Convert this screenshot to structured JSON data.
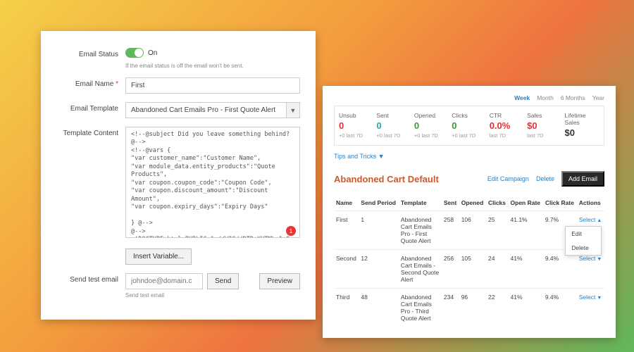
{
  "left": {
    "status": {
      "label": "Email Status",
      "value": "On",
      "hint": "If the email status is off the email won't be sent."
    },
    "name": {
      "label": "Email Name",
      "required": "*",
      "value": "First"
    },
    "template": {
      "label": "Email Template",
      "value": "Abandoned Cart Emails Pro - First Quote Alert"
    },
    "content": {
      "label": "Template Content",
      "value": "<!--@subject Did you leave something behind? @-->\n<!--@vars {\n\"var customer_name\":\"Customer Name\",\n\"var module_data.entity_products\":\"Quote Products\",\n\"var coupon.coupon_code\":\"Coupon Code\",\n\"var coupon.discount_amount\":\"Discount Amount\",\n\"var coupon.expiry_days\":\"Expiry Days\"\n\n} @-->\n@-->\n<!DOCTYPE html PUBLIC \"-//W3C//DTD XHTML 1.0 Transitional//EN\"\n\"http://www.w3.org/TR/xhtml1/DTD/xhtml1-transitional.dtd\">\n<html xmlns:v=\"urn:schemas-microsoft-com:vml\">\n<head>\n  <meta http-equiv=\"Content-Type\" content=\"text/html; charset=UTF-8\" />",
      "badge": "1"
    },
    "insert": "Insert Variable...",
    "test": {
      "label": "Send test email",
      "placeholder": "johndoe@domain.c",
      "send": "Send",
      "preview": "Preview",
      "hint": "Send test email"
    }
  },
  "right": {
    "periods": [
      "Week",
      "Month",
      "6 Months",
      "Year"
    ],
    "stats": [
      {
        "title": "Unsub",
        "val": "0",
        "sub": "+0 last 7D",
        "cls": "v-red"
      },
      {
        "title": "Sent",
        "val": "0",
        "sub": "+0 last 7D",
        "cls": "v-teal"
      },
      {
        "title": "Opened",
        "val": "0",
        "sub": "+0 last 7D",
        "cls": "v-green"
      },
      {
        "title": "Clicks",
        "val": "0",
        "sub": "+0 last 7D",
        "cls": "v-green"
      },
      {
        "title": "CTR",
        "val": "0.0%",
        "sub": "last 7D",
        "cls": "v-red"
      },
      {
        "title": "Sales",
        "val": "$0",
        "sub": "last 7D",
        "cls": "v-red"
      },
      {
        "title": "Lifetime Sales",
        "val": "$0",
        "sub": "",
        "cls": "v-dark"
      }
    ],
    "tips": "Tips and Tricks  ▼",
    "campaign": {
      "title": "Abandoned Cart Default",
      "edit": "Edit Campaign",
      "delete": "Delete",
      "add": "Add Email"
    },
    "headers": [
      "Name",
      "Send Period",
      "Template",
      "Sent",
      "Opened",
      "Clicks",
      "Open Rate",
      "Click Rate",
      "Actions"
    ],
    "rows": [
      {
        "name": "First",
        "period": "1",
        "template": "Abandoned Cart Emails Pro - First Quote Alert",
        "sent": "258",
        "opened": "106",
        "clicks": "25",
        "open": "41.1%",
        "click": "9.7%",
        "action": "Select",
        "open_menu": true
      },
      {
        "name": "Second",
        "period": "12",
        "template": "Abandoned Cart Emails - Second Quote Alert",
        "sent": "256",
        "opened": "105",
        "clicks": "24",
        "open": "41%",
        "click": "9.4%",
        "action": "Select"
      },
      {
        "name": "Third",
        "period": "48",
        "template": "Abandoned Cart Emails Pro - Third Quote Alert",
        "sent": "234",
        "opened": "96",
        "clicks": "22",
        "open": "41%",
        "click": "9.4%",
        "action": "Select"
      }
    ],
    "menu": [
      "Edit",
      "Delete"
    ]
  }
}
